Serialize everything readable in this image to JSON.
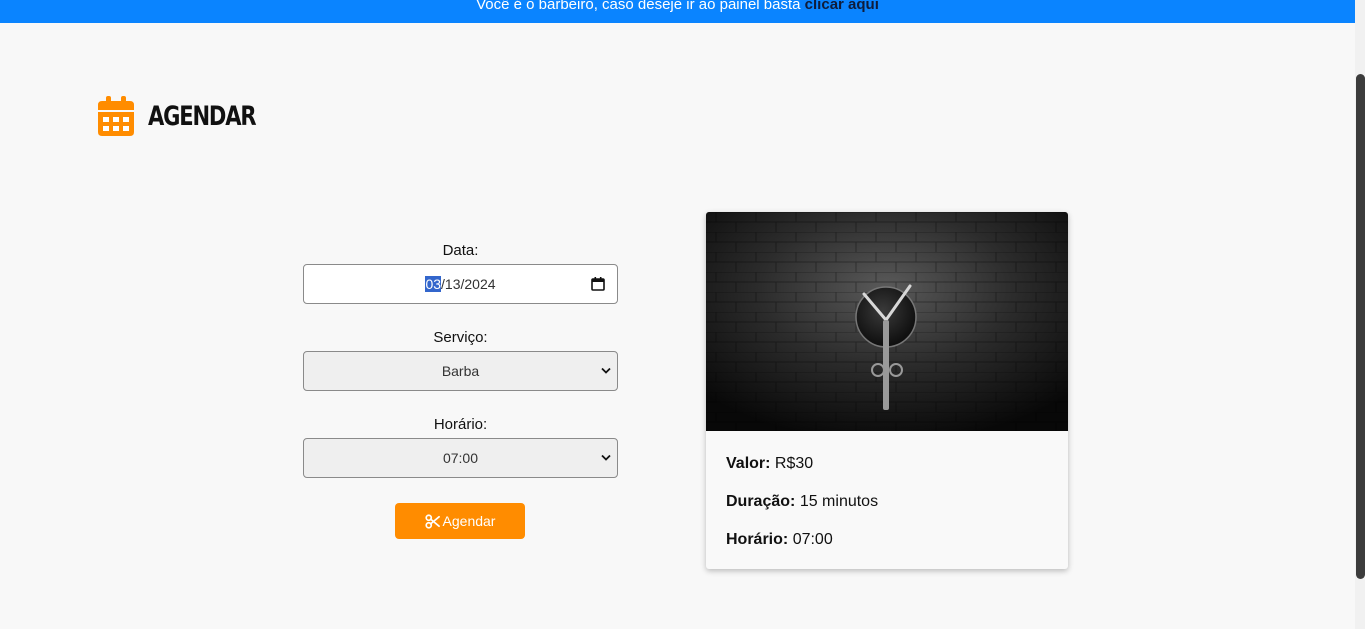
{
  "banner": {
    "text": "Você é o barbeiro, caso deseje ir ao painel basta ",
    "link": "clicar aqui"
  },
  "heading": {
    "icon": "calendar-icon",
    "title": "Agendar",
    "accent": "#ff8c00"
  },
  "form": {
    "date_label": "Data:",
    "date_month": "03",
    "date_rest": "/13/2024",
    "service_label": "Serviço:",
    "service_value": "Barba",
    "time_label": "Horário:",
    "time_value": "07:00",
    "submit_label": "Agendar"
  },
  "card": {
    "image": "scissors-on-brick-wall",
    "price_label": "Valor:",
    "price_value": "R$30",
    "duration_label": "Duração:",
    "duration_value": "15 minutos",
    "time_label": "Horário:",
    "time_value": "07:00"
  },
  "colors": {
    "banner_bg": "#0a84ff",
    "accent": "#ff8c00",
    "background": "#f8f8f8"
  }
}
